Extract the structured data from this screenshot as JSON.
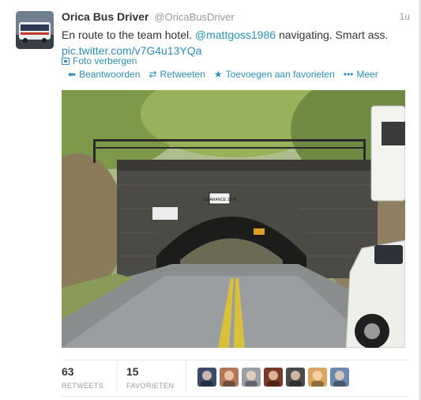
{
  "tweet": {
    "fullname": "Orica Bus Driver",
    "username": "@OricaBusDriver",
    "time": "1u",
    "text_before": "En route to the team hotel.",
    "mention": "@mattgoss1986",
    "text_after": "navigating. Smart ass.",
    "pic_link": "pic.twitter.com/v7G4u13YQa",
    "media_toggle": "Foto verbergen"
  },
  "actions": [
    {
      "label": "Beantwoorden",
      "icon": "reply-icon"
    },
    {
      "label": "Retweeten",
      "icon": "retweet-icon"
    },
    {
      "label": "Toevoegen aan favorieten",
      "icon": "favorite-star-icon"
    },
    {
      "label": "Meer",
      "icon": "more-dots-icon"
    }
  ],
  "photo": {
    "bridge_sign": "CLEARANCE 11'-8\""
  },
  "stats": {
    "retweets_count": "63",
    "retweets_label": "RETWEETS",
    "favorites_count": "15",
    "favorites_label": "FAVORIETEN"
  },
  "favoriters": [
    {
      "color": "#3a4a6a"
    },
    {
      "color": "#b07a5a"
    },
    {
      "color": "#9aa0a8"
    },
    {
      "color": "#7a3a2a"
    },
    {
      "color": "#4a4a4a"
    },
    {
      "color": "#d8a860"
    },
    {
      "color": "#6a8ab0"
    }
  ],
  "colors": {
    "link": "#2a8fbd",
    "muted": "#999999",
    "text": "#333333"
  }
}
